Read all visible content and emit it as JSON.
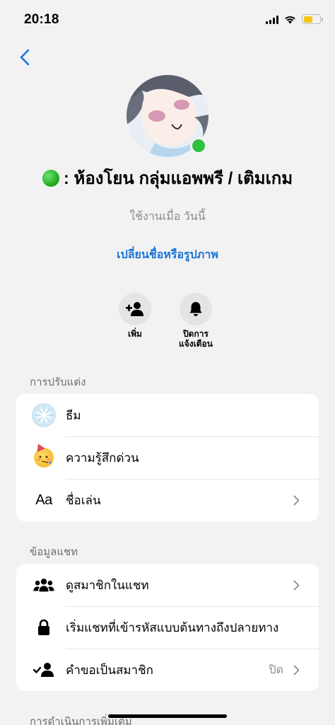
{
  "status_bar": {
    "time": "20:18",
    "battery_level": 0.55
  },
  "header": {
    "back_icon": "chevron-left-icon",
    "accent_color": "#1a73d9"
  },
  "profile": {
    "name": ": ห้องโยน กลุ่มแอพพรี / เติมเกม",
    "active_status": "ใช้งานเมื่อ วันนี้",
    "change_link": "เปลี่ยนชื่อหรือรูปภาพ",
    "online_color": "#31c140"
  },
  "actions": [
    {
      "icon": "add-person-icon",
      "label": "เพิ่ม"
    },
    {
      "icon": "bell-icon",
      "label_line1": "ปิดการ",
      "label_line2": "แจ้งเตือน"
    }
  ],
  "sections": {
    "customize": {
      "title": "การปรับแต่ง",
      "items": [
        {
          "icon": "theme-icon",
          "label": "ธีม"
        },
        {
          "icon": "party-face-emoji-icon",
          "label": "ความรู้สึกด่วน"
        },
        {
          "icon": "text-aa-icon",
          "icon_text": "Aa",
          "label": "ชื่อเล่น"
        }
      ]
    },
    "chat_info": {
      "title": "ข้อมูลแชท",
      "items": [
        {
          "icon": "group-people-icon",
          "label": "ดูสมาชิกในแชท"
        },
        {
          "icon": "lock-icon",
          "label": "เริ่มแชทที่เข้ารหัสแบบต้นทางถึงปลายทาง"
        },
        {
          "icon": "member-request-icon",
          "label": "คำขอเป็นสมาชิก",
          "value": "ปิด"
        }
      ]
    },
    "more_actions": {
      "title": "การดำเนินการเพิ่มเติม"
    }
  }
}
